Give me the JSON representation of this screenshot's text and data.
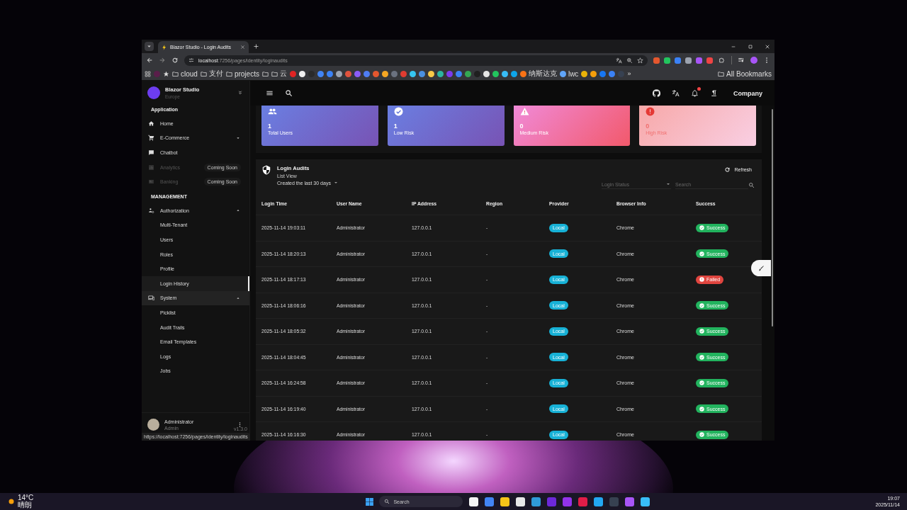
{
  "browser": {
    "tab": {
      "title": "Blazor Studio - Login Audits",
      "selected": true
    },
    "url": {
      "host": "localhost",
      "path": ":7256/pages/identity/loginaudits"
    },
    "bookmarks": [
      {
        "kind": "apps"
      },
      {
        "kind": "favicon",
        "color": "#5a1e4a"
      },
      {
        "kind": "star"
      },
      {
        "kind": "folder",
        "label": "cloud"
      },
      {
        "kind": "folder",
        "label": "支付"
      },
      {
        "kind": "folder",
        "label": "projects"
      },
      {
        "kind": "folder_icon"
      },
      {
        "kind": "folder",
        "label": "云"
      },
      {
        "kind": "favicon",
        "color": "#e02424"
      },
      {
        "kind": "favicon",
        "color": "#f0f0f0"
      },
      {
        "kind": "favicon",
        "color": "#2a2a2a"
      },
      {
        "kind": "favicon",
        "color": "#4285f4"
      },
      {
        "kind": "favicon",
        "color": "#3b82f6"
      },
      {
        "kind": "favicon",
        "color": "#9ca3af"
      },
      {
        "kind": "favicon",
        "color": "#e0533d"
      },
      {
        "kind": "favicon",
        "color": "#8b5cf6"
      },
      {
        "kind": "favicon",
        "color": "#4f7df3"
      },
      {
        "kind": "favicon",
        "color": "#e4572e"
      },
      {
        "kind": "favicon",
        "color": "#f5a623"
      },
      {
        "kind": "favicon",
        "color": "#6b7280"
      },
      {
        "kind": "favicon",
        "color": "#e03c31"
      },
      {
        "kind": "favicon",
        "color": "#36c5f0"
      },
      {
        "kind": "favicon",
        "color": "#4a90e2"
      },
      {
        "kind": "favicon",
        "color": "#f7c948"
      },
      {
        "kind": "favicon",
        "color": "#2bb5a0"
      },
      {
        "kind": "favicon",
        "color": "#7c3aed"
      },
      {
        "kind": "favicon",
        "color": "#3b82f6"
      },
      {
        "kind": "favicon",
        "color": "#34a853"
      },
      {
        "kind": "favicon",
        "color": "#1f1f1f"
      },
      {
        "kind": "favicon",
        "color": "#e5e5e5"
      },
      {
        "kind": "favicon",
        "color": "#22c55e"
      },
      {
        "kind": "favicon",
        "color": "#38bdf8"
      },
      {
        "kind": "favicon",
        "color": "#0ea5e9"
      },
      {
        "kind": "link",
        "label": "纳斯达克",
        "color": "#f97316"
      },
      {
        "kind": "link",
        "label": "lwc",
        "color": "#60a5fa"
      },
      {
        "kind": "favicon",
        "color": "#eab308"
      },
      {
        "kind": "favicon",
        "color": "#f59e0b"
      },
      {
        "kind": "favicon",
        "color": "#1877f2"
      },
      {
        "kind": "favicon",
        "color": "#3b82f6"
      },
      {
        "kind": "favicon",
        "color": "#374151"
      },
      {
        "kind": "more",
        "label": "»"
      },
      {
        "kind": "folder",
        "label": "All Bookmarks"
      }
    ]
  },
  "app": {
    "brand": {
      "name": "Blazor Studio",
      "region": "Europe"
    },
    "sidebar": {
      "sections": [
        {
          "title": "Application",
          "items": [
            {
              "label": "Home",
              "kind": "home",
              "disabled": false,
              "hovered": false
            },
            {
              "label": "E-Commerce",
              "kind": "cart",
              "disabled": false,
              "hovered": false,
              "expanded": false
            },
            {
              "label": "Chatbot",
              "kind": "chat",
              "disabled": false,
              "hovered": false
            },
            {
              "label": "Analytics",
              "kind": "chart",
              "disabled": true,
              "hovered": false,
              "badge": "Coming Soon"
            },
            {
              "label": "Banking",
              "kind": "bank",
              "disabled": true,
              "hovered": false,
              "badge": "Coming Soon"
            }
          ]
        },
        {
          "title": "MANAGEMENT",
          "items": [
            {
              "label": "Authorization",
              "kind": "people",
              "disabled": false,
              "hovered": false,
              "expanded": true,
              "children": [
                {
                  "label": "Multi-Tenant",
                  "selected": false
                },
                {
                  "label": "Users",
                  "selected": false
                },
                {
                  "label": "Roles",
                  "selected": false
                },
                {
                  "label": "Profile",
                  "selected": false
                },
                {
                  "label": "Login History",
                  "selected": true
                }
              ]
            },
            {
              "label": "System",
              "kind": "devices",
              "disabled": false,
              "hovered": true,
              "expanded": true,
              "children": [
                {
                  "label": "Picklist",
                  "selected": false
                },
                {
                  "label": "Audit Trails",
                  "selected": false
                },
                {
                  "label": "Email Templates",
                  "selected": false
                },
                {
                  "label": "Logs",
                  "selected": false
                },
                {
                  "label": "Jobs",
                  "selected": false
                }
              ]
            }
          ]
        }
      ],
      "user": {
        "name": "Administrator",
        "role": "Admin"
      },
      "version": "v1.3.0"
    },
    "header": {
      "has_notification": true,
      "company": "Company"
    },
    "cards": [
      {
        "kind": "users",
        "value": "1",
        "label": "Total Users"
      },
      {
        "kind": "low",
        "value": "1",
        "label": "Low Risk"
      },
      {
        "kind": "medium",
        "value": "0",
        "label": "Medium Risk"
      },
      {
        "kind": "high",
        "value": "0",
        "label": "High Risk"
      }
    ],
    "audits": {
      "title": "Login Audits",
      "view_label": "List View",
      "view": "Created the last 30 days",
      "refresh": "Refresh",
      "status_filter": {
        "placeholder": "Login Status"
      },
      "search": {
        "placeholder": "Search"
      },
      "columns": [
        "Login Time",
        "User Name",
        "IP Address",
        "Region",
        "Provider",
        "Browser Info",
        "Success"
      ],
      "rows": [
        {
          "login_time": "2025-11-14 19:03:11",
          "user_name": "Administrator",
          "ip": "127.0.0.1",
          "region": "-",
          "provider": "Local",
          "browser": "Chrome",
          "status": {
            "kind": "success",
            "label": "Success"
          }
        },
        {
          "login_time": "2025-11-14 18:20:13",
          "user_name": "Administrator",
          "ip": "127.0.0.1",
          "region": "-",
          "provider": "Local",
          "browser": "Chrome",
          "status": {
            "kind": "success",
            "label": "Success"
          }
        },
        {
          "login_time": "2025-11-14 18:17:13",
          "user_name": "Administrator",
          "ip": "127.0.0.1",
          "region": "-",
          "provider": "Local",
          "browser": "Chrome",
          "status": {
            "kind": "failed",
            "label": "Failed"
          }
        },
        {
          "login_time": "2025-11-14 18:06:16",
          "user_name": "Administrator",
          "ip": "127.0.0.1",
          "region": "-",
          "provider": "Local",
          "browser": "Chrome",
          "status": {
            "kind": "success",
            "label": "Success"
          }
        },
        {
          "login_time": "2025-11-14 18:05:32",
          "user_name": "Administrator",
          "ip": "127.0.0.1",
          "region": "-",
          "provider": "Local",
          "browser": "Chrome",
          "status": {
            "kind": "success",
            "label": "Success"
          }
        },
        {
          "login_time": "2025-11-14 18:04:45",
          "user_name": "Administrator",
          "ip": "127.0.0.1",
          "region": "-",
          "provider": "Local",
          "browser": "Chrome",
          "status": {
            "kind": "success",
            "label": "Success"
          }
        },
        {
          "login_time": "2025-11-14 16:24:58",
          "user_name": "Administrator",
          "ip": "127.0.0.1",
          "region": "-",
          "provider": "Local",
          "browser": "Chrome",
          "status": {
            "kind": "success",
            "label": "Success"
          }
        },
        {
          "login_time": "2025-11-14 16:19:40",
          "user_name": "Administrator",
          "ip": "127.0.0.1",
          "region": "-",
          "provider": "Local",
          "browser": "Chrome",
          "status": {
            "kind": "success",
            "label": "Success"
          }
        },
        {
          "login_time": "2025-11-14 16:16:30",
          "user_name": "Administrator",
          "ip": "127.0.0.1",
          "region": "-",
          "provider": "Local",
          "browser": "Chrome",
          "status": {
            "kind": "success",
            "label": "Success"
          }
        }
      ]
    },
    "status_url": "https://localhost:7256/pages/identity/loginaudits"
  },
  "taskbar": {
    "weather": {
      "temp": "14°C",
      "condition": "晴朗"
    },
    "search": {
      "placeholder": "Search"
    },
    "apps": [
      {
        "color": "#f5f5f5"
      },
      {
        "color": "#4285f4"
      },
      {
        "color": "#f5c518"
      },
      {
        "color": "#e8e8e8"
      },
      {
        "color": "#2f9bd9"
      },
      {
        "color": "#6d28d9"
      },
      {
        "color": "#9333ea"
      },
      {
        "color": "#e11d48"
      },
      {
        "color": "#23a8f2"
      },
      {
        "color": "#374151"
      },
      {
        "color": "#a855f7"
      },
      {
        "color": "#38bdf8"
      }
    ],
    "time": "19:07",
    "date": "2025/11/14"
  }
}
